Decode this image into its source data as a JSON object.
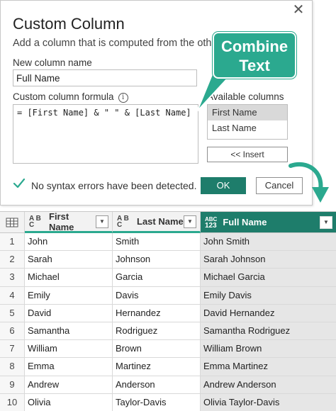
{
  "dialog": {
    "title": "Custom Column",
    "close_glyph": "✕",
    "description": "Add a column that is computed from the other columns.",
    "new_column_label": "New column name",
    "new_column_value": "Full Name",
    "formula_label": "Custom column formula",
    "info_glyph": "i",
    "formula": "= [First Name] & \" \" & [Last Name]",
    "available_label": "Available columns",
    "available_columns": [
      "First Name",
      "Last Name"
    ],
    "insert_label": "<< Insert",
    "status": "No syntax errors have been detected.",
    "ok_label": "OK",
    "cancel_label": "Cancel"
  },
  "callout": {
    "line1": "Combine",
    "line2": "Text",
    "color": "#2ba98f"
  },
  "grid": {
    "headers": {
      "first": "First Name",
      "last": "Last Name",
      "full": "Full Name",
      "text_type_icon": "A B C",
      "any_type_icon_top": "ABC",
      "any_type_icon_bottom": "123"
    },
    "rows": [
      {
        "n": "1",
        "first": "John",
        "last": "Smith",
        "full": "John Smith"
      },
      {
        "n": "2",
        "first": "Sarah",
        "last": "Johnson",
        "full": "Sarah Johnson"
      },
      {
        "n": "3",
        "first": "Michael",
        "last": "Garcia",
        "full": "Michael Garcia"
      },
      {
        "n": "4",
        "first": "Emily",
        "last": "Davis",
        "full": "Emily Davis"
      },
      {
        "n": "5",
        "first": "David",
        "last": "Hernandez",
        "full": "David Hernandez"
      },
      {
        "n": "6",
        "first": "Samantha",
        "last": "Rodriguez",
        "full": "Samantha Rodriguez"
      },
      {
        "n": "7",
        "first": "William",
        "last": "Brown",
        "full": "William Brown"
      },
      {
        "n": "8",
        "first": "Emma",
        "last": "Martinez",
        "full": "Emma Martinez"
      },
      {
        "n": "9",
        "first": "Andrew",
        "last": "Anderson",
        "full": "Andrew Anderson"
      },
      {
        "n": "10",
        "first": "Olivia",
        "last": "Taylor-Davis",
        "full": "Olivia Taylor-Davis"
      }
    ]
  },
  "colors": {
    "accent": "#2ba98f",
    "ok_button": "#1e7d6b",
    "selected_column_header": "#1e7d6b"
  }
}
